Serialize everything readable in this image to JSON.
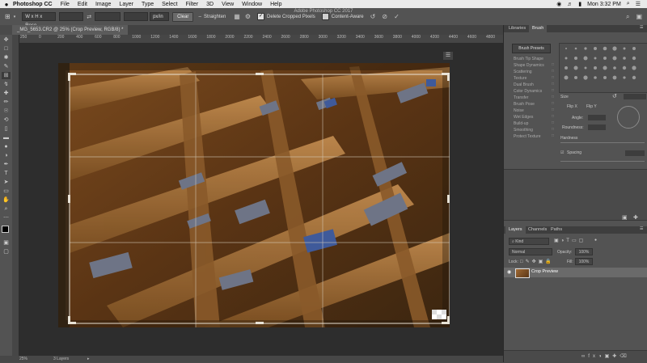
{
  "menubar": {
    "apple": "",
    "app_name": "Photoshop CC",
    "items": [
      "File",
      "Edit",
      "Image",
      "Layer",
      "Type",
      "Select",
      "Filter",
      "3D",
      "View",
      "Window",
      "Help"
    ],
    "time": "Mon 3:32 PM",
    "accent": "#e9e9e9"
  },
  "window": {
    "title": "Adobe Photoshop CC 2017"
  },
  "options": {
    "ratio_select": "W x H x Reso...",
    "units_select": "px/in",
    "clear_label": "Clear",
    "straighten_label": "Straighten",
    "delete_cropped_label": "Delete Cropped Pixels",
    "delete_cropped_checked": true,
    "content_aware_label": "Content-Aware",
    "content_aware_checked": false
  },
  "document": {
    "tab_label": "_MG_5653.CR2 @ 25% (Crop Preview, RGB/8) *",
    "ruler_ticks": [
      "250",
      "0",
      "200",
      "400",
      "600",
      "800",
      "1000",
      "1200",
      "1400",
      "1600",
      "1800",
      "2000",
      "2200",
      "2400",
      "2600",
      "2800",
      "3000",
      "3200",
      "3400",
      "3600",
      "3800",
      "4000",
      "4200",
      "4400",
      "4600",
      "4800"
    ]
  },
  "statusbar": {
    "zoom": "25%",
    "layers": "3 Layers"
  },
  "panels": {
    "top_tabs": [
      "Libraries",
      "Brush"
    ],
    "brush_presets_button": "Brush Presets",
    "brush_items": [
      "Brush Tip Shape",
      "Shape Dynamics",
      "Scattering",
      "Texture",
      "Dual Brush",
      "Color Dynamics",
      "Transfer",
      "Brush Pose",
      "Noise",
      "Wet Edges",
      "Build-up",
      "Smoothing",
      "Protect Texture"
    ],
    "size_label": "Size",
    "flip_x": "Flip X",
    "flip_y": "Flip Y",
    "angle_label": "Angle:",
    "roundness_label": "Roundness:",
    "hardness_label": "Hardness",
    "spacing_label": "Spacing",
    "layer_tabs": [
      "Layers",
      "Channels",
      "Paths"
    ],
    "kind_label": "Kind",
    "blend_mode": "Normal",
    "opacity_label": "Opacity:",
    "opacity_value": "100%",
    "lock_label": "Lock:",
    "fill_label": "Fill:",
    "fill_value": "100%",
    "layer_name": "Crop Preview"
  }
}
